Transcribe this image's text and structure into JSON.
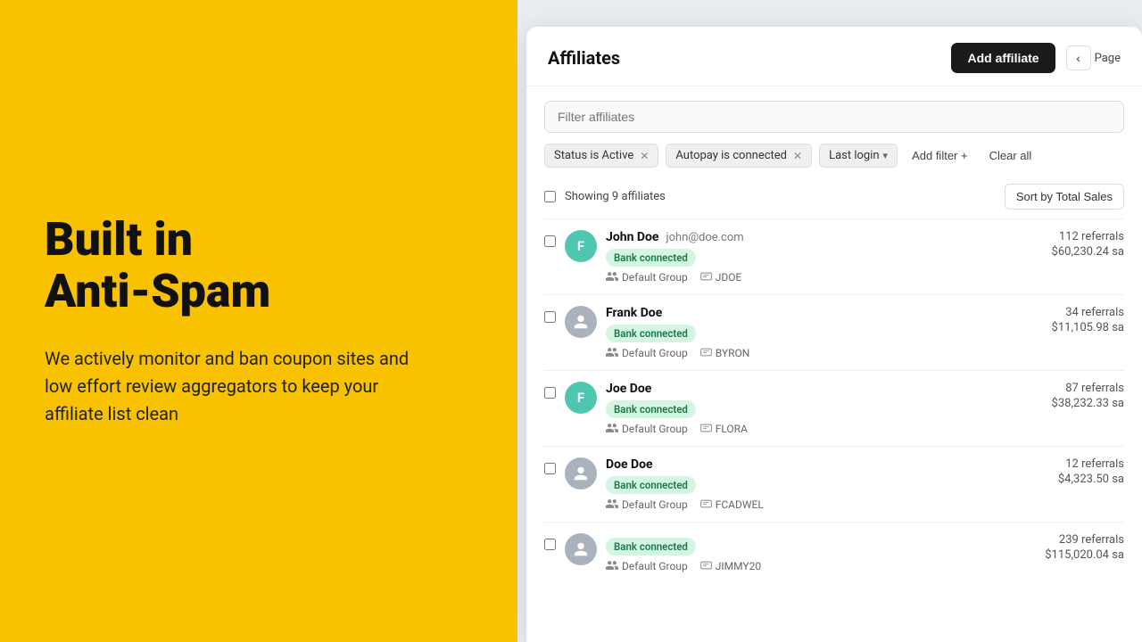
{
  "left": {
    "headline_line1": "Built in",
    "headline_line2": "Anti-Spam",
    "subtext": "We actively monitor and ban coupon sites and low effort review aggregators to keep your affiliate list clean"
  },
  "app": {
    "title": "Affiliates",
    "add_btn": "Add affiliate",
    "page_label": "Page",
    "search_placeholder": "Filter affiliates",
    "filters": [
      {
        "label": "Status is Active",
        "removable": true
      },
      {
        "label": "Autopay is connected",
        "removable": true
      },
      {
        "label": "Last login",
        "dropdown": true
      }
    ],
    "add_filter": "Add filter +",
    "clear_all": "Clear all",
    "showing_label": "Showing 9 affiliates",
    "sort_label": "Sort by Total Sales",
    "affiliates": [
      {
        "name": "John Doe",
        "email": "john@doe.com",
        "avatar_type": "teal",
        "avatar_letter": "F",
        "bank_connected": true,
        "group": "Default Group",
        "code": "JDOE",
        "referrals": "112 referrals",
        "sales": "$60,230.24 sa"
      },
      {
        "name": "Frank Doe",
        "email": "",
        "avatar_type": "gray",
        "avatar_letter": "",
        "bank_connected": true,
        "group": "Default Group",
        "code": "BYRON",
        "referrals": "34 referrals",
        "sales": "$11,105.98 sa"
      },
      {
        "name": "Joe Doe",
        "email": "",
        "avatar_type": "teal",
        "avatar_letter": "F",
        "bank_connected": true,
        "group": "Default Group",
        "code": "FLORA",
        "referrals": "87 referrals",
        "sales": "$38,232.33 sa"
      },
      {
        "name": "Doe Doe",
        "email": "",
        "avatar_type": "gray",
        "avatar_letter": "",
        "bank_connected": true,
        "group": "Default Group",
        "code": "FCADWEL",
        "referrals": "12 referrals",
        "sales": "$4,323.50 sa"
      },
      {
        "name": "",
        "email": "",
        "avatar_type": "gray",
        "avatar_letter": "",
        "bank_connected": true,
        "group": "Default Group",
        "code": "JIMMY20",
        "referrals": "239 referrals",
        "sales": "$115,020.04 sa"
      }
    ],
    "bank_connected_label": "Bank connected"
  }
}
